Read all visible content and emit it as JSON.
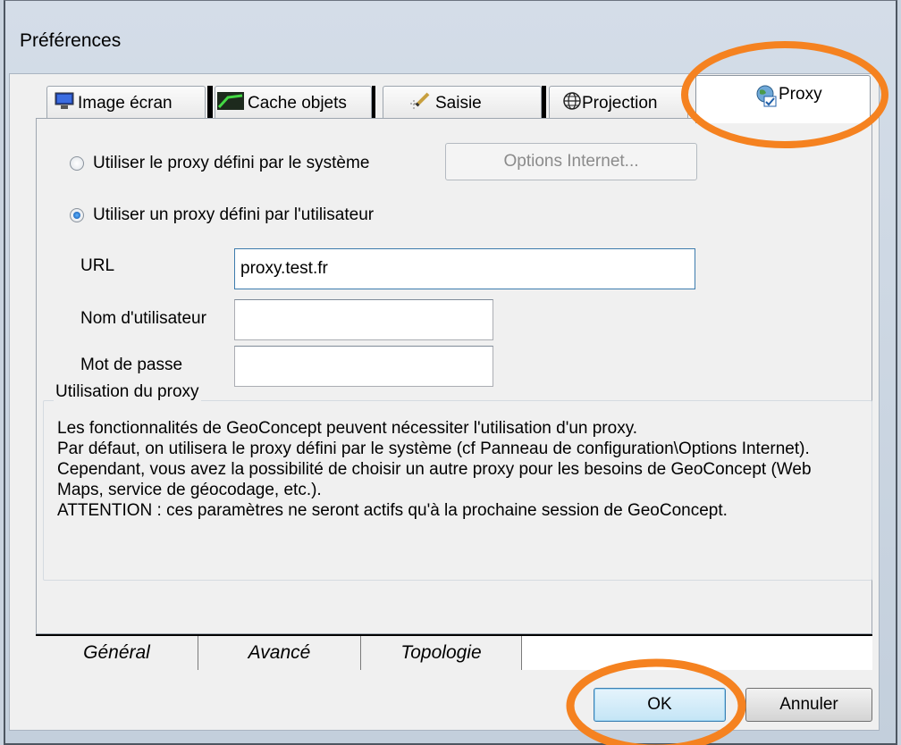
{
  "window": {
    "title": "Préférences"
  },
  "tabs": [
    {
      "label": "Image écran",
      "icon": "monitor-icon"
    },
    {
      "label": "Cache objets",
      "icon": "chart-icon"
    },
    {
      "label": "Saisie",
      "icon": "pencil-icon"
    },
    {
      "label": "Projection",
      "icon": "globe-icon"
    },
    {
      "label": "Proxy",
      "icon": "proxy-globe-icon",
      "active": true
    }
  ],
  "proxy": {
    "system_radio_label": "Utiliser le proxy défini par le système",
    "internet_options_button": "Options Internet...",
    "user_radio_label": "Utiliser un proxy défini par l'utilisateur",
    "url_label": "URL",
    "url_value": "proxy.test.fr",
    "username_label": "Nom d'utilisateur",
    "username_value": "",
    "password_label": "Mot de passe",
    "password_value": "",
    "selected": "user"
  },
  "usage": {
    "title": "Utilisation du proxy",
    "lines": [
      "Les fonctionnalités de GeoConcept peuvent nécessiter l'utilisation d'un proxy.",
      "Par défaut, on utilisera le proxy défini par le système (cf Panneau de configuration\\Options Internet).",
      "Cependant, vous avez la possibilité de choisir un autre proxy pour les besoins de GeoConcept (Web Maps, service de géocodage, etc.).",
      "ATTENTION : ces paramètres ne seront actifs qu'à la prochaine session de GeoConcept."
    ]
  },
  "bottom_tabs": [
    "Général",
    "Avancé",
    "Topologie"
  ],
  "buttons": {
    "ok": "OK",
    "cancel": "Annuler"
  },
  "colors": {
    "annotation": "#f58220",
    "ok_border": "#3c7fb1"
  }
}
